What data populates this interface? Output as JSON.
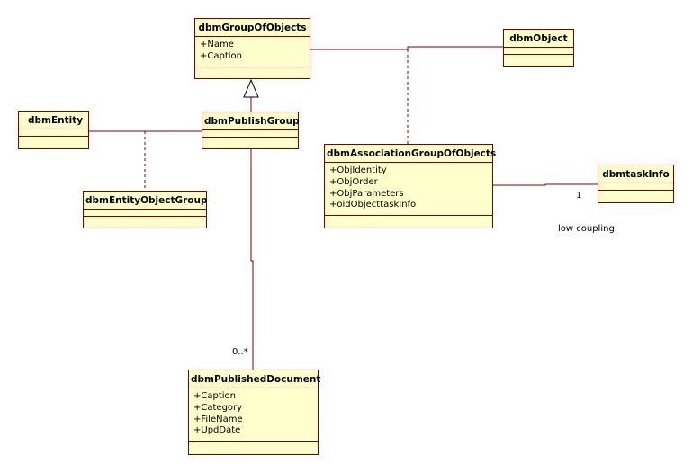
{
  "classes": {
    "group_of_objects": {
      "name": "dbmGroupOfObjects",
      "attributes": [
        "+Name",
        "+Caption"
      ]
    },
    "object": {
      "name": "dbmObject"
    },
    "entity": {
      "name": "dbmEntity"
    },
    "publish_group": {
      "name": "dbmPublishGroup"
    },
    "association_group": {
      "name": "dbmAssociationGroupOfObjects",
      "attributes": [
        "+ObjIdentity",
        "+ObjOrder",
        "+ObjParameters",
        "+oidObjecttaskInfo"
      ]
    },
    "task_info": {
      "name": "dbmtaskInfo"
    },
    "entity_object_group": {
      "name": "dbmEntityObjectGroup"
    },
    "published_document": {
      "name": "dbmPublishedDocument",
      "attributes": [
        "+Caption",
        "+Category",
        "+FileName",
        "+UpdDate"
      ]
    }
  },
  "labels": {
    "multiplicity_one": "1",
    "multiplicity_many": "0..*",
    "note": "low coupling"
  },
  "colors": {
    "fill": "#ffffcc",
    "border": "#800000",
    "line": "#800000"
  }
}
